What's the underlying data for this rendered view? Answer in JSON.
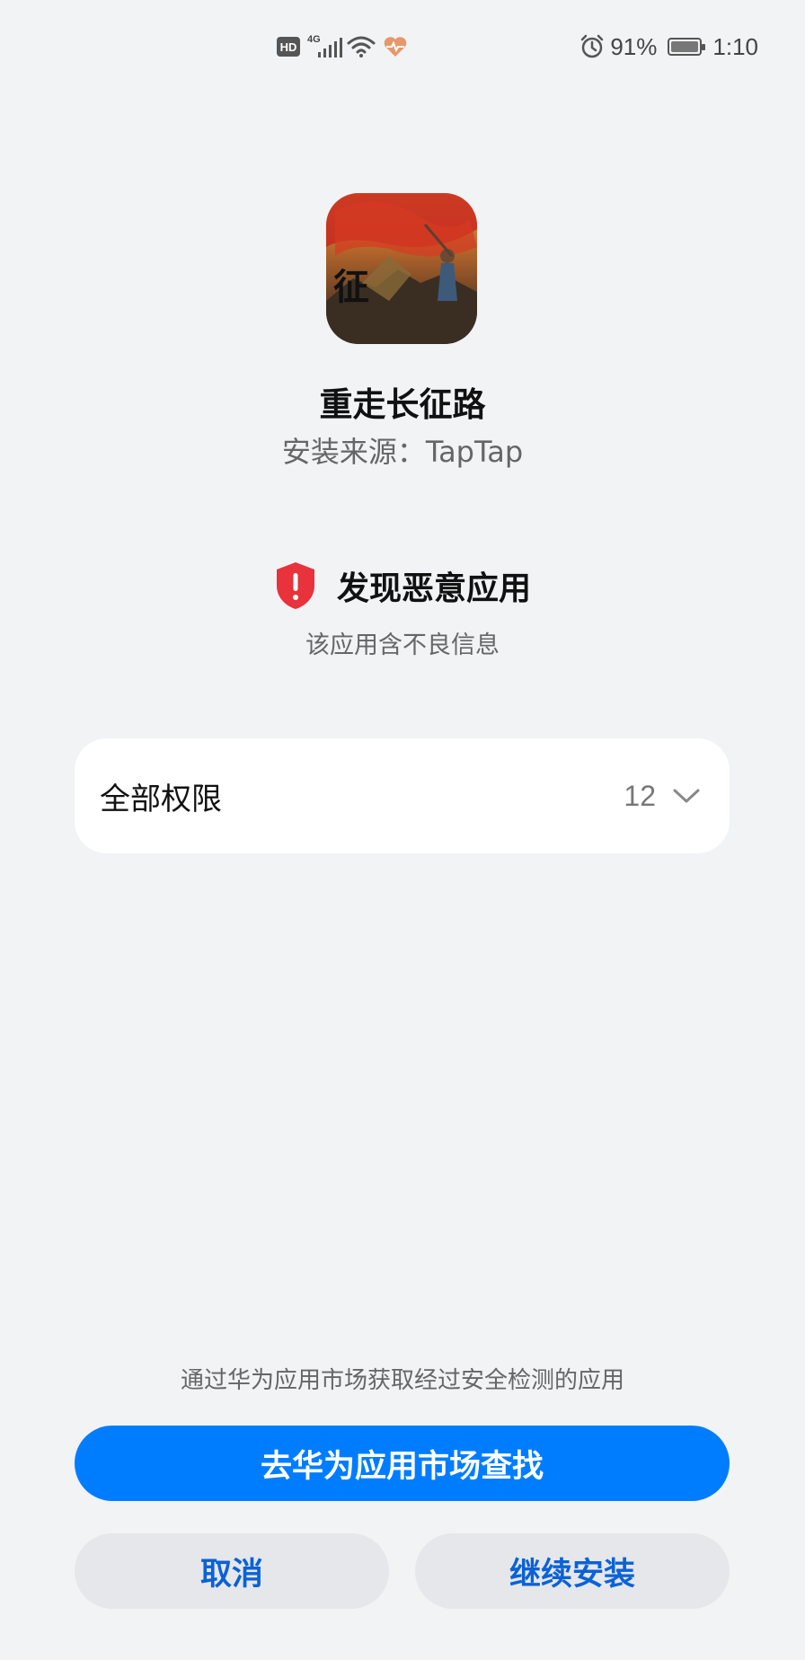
{
  "status_bar": {
    "hd_label": "HD",
    "network_label": "4G",
    "battery_percent": "91%",
    "time": "1:10",
    "icons": [
      "hd-icon",
      "signal-icon",
      "wifi-icon",
      "health-icon",
      "alarm-icon",
      "battery-icon"
    ],
    "battery_level": 0.91
  },
  "app": {
    "name": "重走长征路",
    "source": "安装来源：TapTap",
    "icon_name": "app-icon"
  },
  "warning": {
    "title": "发现恶意应用",
    "description": "该应用含不良信息",
    "icon_color": "#e8323c"
  },
  "permissions": {
    "label": "全部权限",
    "count": "12"
  },
  "bottom": {
    "tip": "通过华为应用市场获取经过安全检测的应用",
    "primary_label": "去华为应用市场查找",
    "cancel_label": "取消",
    "continue_label": "继续安装"
  },
  "colors": {
    "accent": "#007dff",
    "secondary_text": "#0a62d6",
    "background": "#f1f3f5"
  }
}
